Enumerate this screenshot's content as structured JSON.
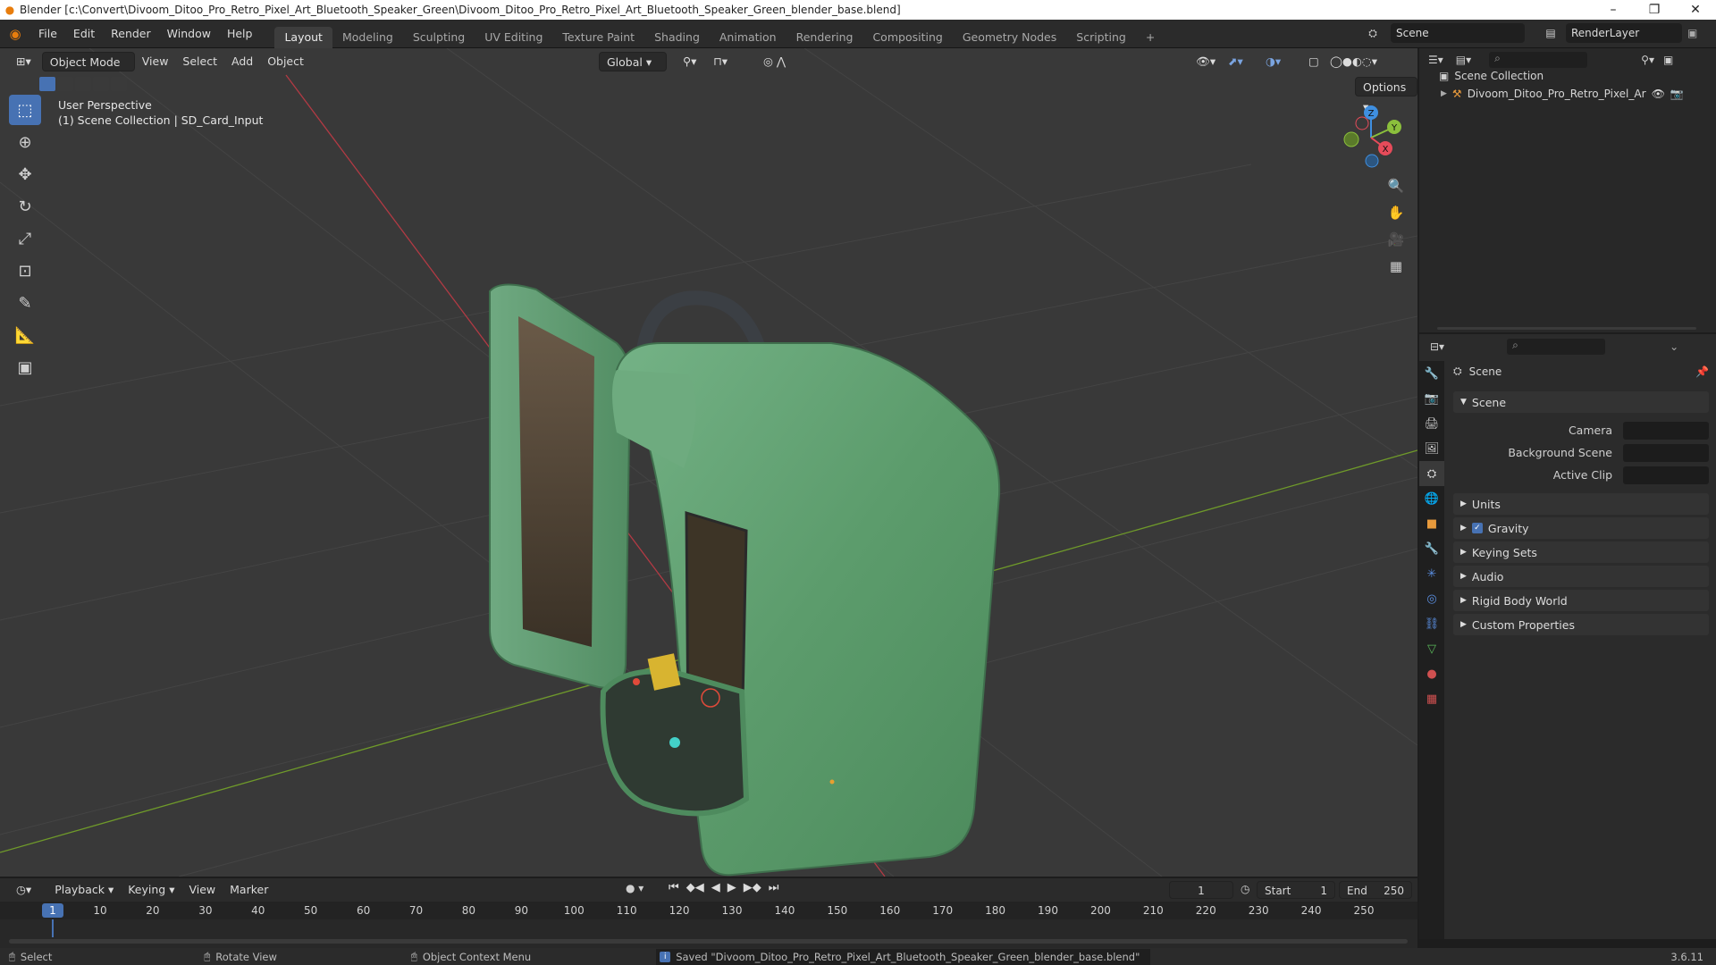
{
  "titlebar": {
    "title": "Blender [c:\\Convert\\Divoom_Ditoo_Pro_Retro_Pixel_Art_Bluetooth_Speaker_Green\\Divoom_Ditoo_Pro_Retro_Pixel_Art_Bluetooth_Speaker_Green_blender_base.blend]",
    "minimize": "–",
    "maximize": "❐",
    "close": "✕"
  },
  "menubar": {
    "menus": [
      "File",
      "Edit",
      "Render",
      "Window",
      "Help"
    ],
    "workspaces": [
      "Layout",
      "Modeling",
      "Sculpting",
      "UV Editing",
      "Texture Paint",
      "Shading",
      "Animation",
      "Rendering",
      "Compositing",
      "Geometry Nodes",
      "Scripting"
    ],
    "add_tab": "+",
    "scene_name": "Scene",
    "view_layer": "RenderLayer"
  },
  "viewport": {
    "mode": "Object Mode",
    "menus": [
      "View",
      "Select",
      "Add",
      "Object"
    ],
    "transform_orientation": "Global",
    "options": "Options",
    "perspective_label": "User Perspective",
    "collection_label": "(1) Scene Collection | SD_Card_Input",
    "gizmo": {
      "x": "X",
      "y": "Y",
      "z": "Z"
    }
  },
  "outliner": {
    "root": "Scene Collection",
    "items": [
      "Divoom_Ditoo_Pro_Retro_Pixel_Art_Blue"
    ]
  },
  "properties": {
    "header": "Scene",
    "panel_title": "Scene",
    "fields": {
      "camera": "Camera",
      "background_scene": "Background Scene",
      "active_clip": "Active Clip"
    },
    "sections": [
      "Units",
      "Gravity",
      "Keying Sets",
      "Audio",
      "Rigid Body World",
      "Custom Properties"
    ],
    "gravity_checked": true
  },
  "timeline": {
    "menus": [
      "Playback",
      "Keying",
      "View",
      "Marker"
    ],
    "current_frame": "1",
    "start_label": "Start",
    "start": "1",
    "end_label": "End",
    "end": "250",
    "ticks": [
      "1",
      "10",
      "20",
      "30",
      "40",
      "50",
      "60",
      "70",
      "80",
      "90",
      "100",
      "110",
      "120",
      "130",
      "140",
      "150",
      "160",
      "170",
      "180",
      "190",
      "200",
      "210",
      "220",
      "230",
      "240",
      "250"
    ]
  },
  "statusbar": {
    "select": "Select",
    "rotate": "Rotate View",
    "context": "Object Context Menu",
    "message": "Saved \"Divoom_Ditoo_Pro_Retro_Pixel_Art_Bluetooth_Speaker_Green_blender_base.blend\"",
    "version": "3.6.11"
  },
  "colors": {
    "accent": "#4772b3",
    "model_green": "#5fa070",
    "x_axis": "#e64b5a",
    "y_axis": "#8bbf3c",
    "z_axis": "#3f8fe0"
  }
}
